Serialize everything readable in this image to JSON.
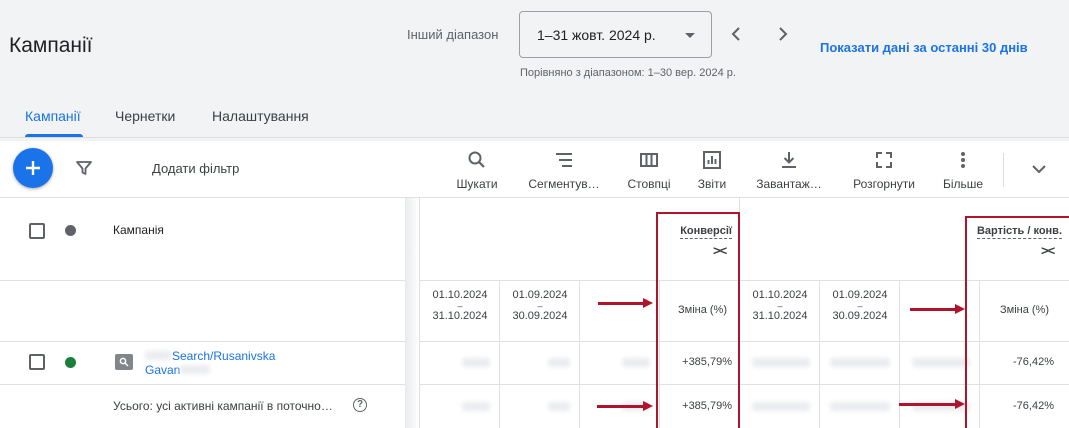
{
  "header": {
    "title": "Кампанії",
    "range_label": "Інший діапазон",
    "range_value": "1–31 жовт. 2024 р.",
    "compare_note": "Порівняно з діапазоном: 1–30 вер. 2024 р.",
    "show_last_30": "Показати дані за останні 30 днів"
  },
  "tabs": [
    {
      "label": "Кампанії",
      "active": true
    },
    {
      "label": "Чернетки",
      "active": false
    },
    {
      "label": "Налаштування",
      "active": false
    }
  ],
  "toolbar": {
    "add_filter": "Додати фільтр",
    "tools": [
      {
        "label": "Шукати",
        "icon": "search-icon"
      },
      {
        "label": "Сегментув…",
        "icon": "segment-icon"
      },
      {
        "label": "Стовпці",
        "icon": "columns-icon"
      },
      {
        "label": "Звіти",
        "icon": "reports-icon"
      },
      {
        "label": "Завантаж…",
        "icon": "download-icon"
      },
      {
        "label": "Розгорнути",
        "icon": "fullscreen-icon"
      },
      {
        "label": "Більше",
        "icon": "more-vert-icon"
      }
    ]
  },
  "table": {
    "campaign_header": "Кампанія",
    "metrics": [
      {
        "name": "Конверсії",
        "collapse": "><"
      },
      {
        "name": "Вартість / конв.",
        "collapse": "><"
      }
    ],
    "date_current": [
      "01.10.2024",
      "–",
      "31.10.2024"
    ],
    "date_previous": [
      "01.09.2024",
      "–",
      "30.09.2024"
    ],
    "change_label": "Зміна (%)",
    "rows": [
      {
        "campaign": "Search/Rusanivska Gavan",
        "status_color": "#188038",
        "conv_change": "+385,79%",
        "cost_change": "-76,42%"
      }
    ],
    "total": {
      "label": "Усього: усі активні кампанії в поточно…",
      "help": "?",
      "conv_change": "+385,79%",
      "cost_change": "-76,42%"
    }
  },
  "colors": {
    "accent": "#1a73e8",
    "annotation": "#b0142c",
    "status_enabled": "#188038"
  }
}
